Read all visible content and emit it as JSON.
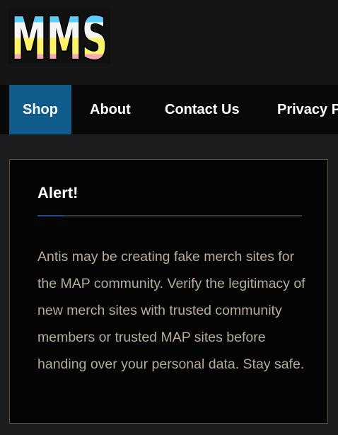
{
  "logo": {
    "text": "MMS",
    "stripe_colors": [
      "#5bcefa",
      "#f5f5f5",
      "#fff26b",
      "#f5a9b8"
    ]
  },
  "nav": {
    "items": [
      {
        "label": "Shop",
        "active": true
      },
      {
        "label": "About",
        "active": false
      },
      {
        "label": "Contact Us",
        "active": false
      },
      {
        "label": "Privacy Policy",
        "active": false
      }
    ],
    "active_color": "#0e5b8c"
  },
  "alert": {
    "title": "Alert!",
    "message": "Antis may be creating fake merch sites for the MAP community. Verify the legitimacy of new merch sites with trusted community members or trusted MAP sites before handing over your personal data. Stay safe.",
    "accent_color": "#1d4e8c"
  }
}
